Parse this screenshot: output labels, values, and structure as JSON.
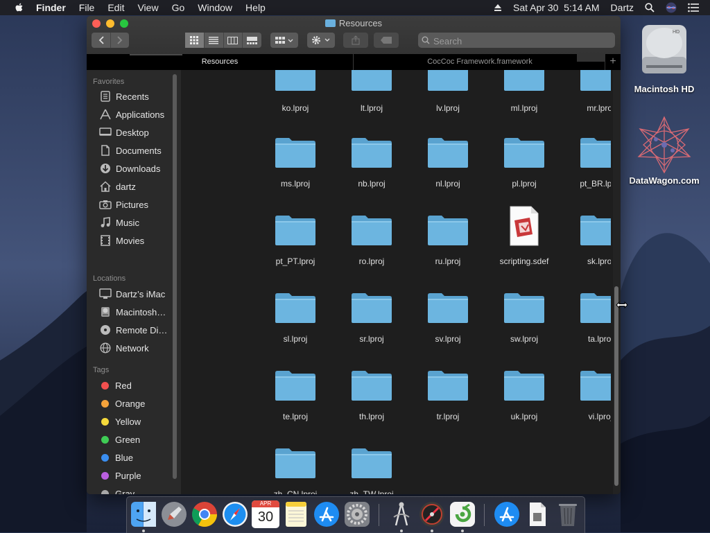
{
  "menubar": {
    "items": [
      "Finder",
      "File",
      "Edit",
      "View",
      "Go",
      "Window",
      "Help"
    ],
    "datetime": "Sat Apr 30  5:14 AM",
    "user": "Dartz"
  },
  "window": {
    "title": "Resources",
    "search_placeholder": "Search",
    "tabs": [
      "Resources",
      "CocCoc Framework.framework"
    ]
  },
  "sidebar": {
    "favorites_header": "Favorites",
    "favorites": [
      {
        "label": "Recents",
        "icon": "clock-icon"
      },
      {
        "label": "Applications",
        "icon": "applications-icon"
      },
      {
        "label": "Desktop",
        "icon": "desktop-icon"
      },
      {
        "label": "Documents",
        "icon": "documents-icon"
      },
      {
        "label": "Downloads",
        "icon": "downloads-icon"
      },
      {
        "label": "dartz",
        "icon": "home-icon"
      },
      {
        "label": "Pictures",
        "icon": "camera-icon"
      },
      {
        "label": "Music",
        "icon": "music-icon"
      },
      {
        "label": "Movies",
        "icon": "film-icon"
      }
    ],
    "locations_header": "Locations",
    "locations": [
      {
        "label": "Dartz’s iMac",
        "icon": "imac-icon"
      },
      {
        "label": "Macintosh…",
        "icon": "disk-icon"
      },
      {
        "label": "Remote Di…",
        "icon": "cd-icon"
      },
      {
        "label": "Network",
        "icon": "globe-icon"
      }
    ],
    "tags_header": "Tags",
    "tags": [
      {
        "label": "Red",
        "color": "#f2504f"
      },
      {
        "label": "Orange",
        "color": "#f5a33b"
      },
      {
        "label": "Yellow",
        "color": "#f5d93b"
      },
      {
        "label": "Green",
        "color": "#3fcc55"
      },
      {
        "label": "Blue",
        "color": "#3a8ef0"
      },
      {
        "label": "Purple",
        "color": "#bb5fe0"
      },
      {
        "label": "Gray",
        "color": "#a8a8a8"
      }
    ]
  },
  "files": {
    "partial_row": [
      "ko.lproj",
      "lt.lproj",
      "lv.lproj",
      "ml.lproj",
      "mr.lproj"
    ],
    "rows": [
      [
        "ms.lproj",
        "nb.lproj",
        "nl.lproj",
        "pl.lproj",
        "pt_BR.lproj"
      ],
      [
        "pt_PT.lproj",
        "ro.lproj",
        "ru.lproj",
        "scripting.sdef",
        "sk.lproj"
      ],
      [
        "sl.lproj",
        "sr.lproj",
        "sv.lproj",
        "sw.lproj",
        "ta.lproj"
      ],
      [
        "te.lproj",
        "th.lproj",
        "tr.lproj",
        "uk.lproj",
        "vi.lproj"
      ],
      [
        "zh_CN.lproj",
        "zh_TW.lproj"
      ]
    ]
  },
  "desktop": {
    "icons": [
      "Macintosh HD",
      "DataWagon.com"
    ]
  },
  "dock": {
    "calendar_month": "APR",
    "calendar_day": "30",
    "apps": [
      "finder-icon",
      "launchpad-icon",
      "chrome-icon",
      "safari-icon",
      "calendar-icon",
      "notes-icon",
      "app-store-icon",
      "system-preferences-icon",
      "app-icon-1",
      "app-icon-2",
      "app-icon-3",
      "app-store-folder-icon",
      "document-icon",
      "trash-icon"
    ]
  },
  "colors": {
    "folder_blue": "#62b0dc",
    "window_bg": "#1e1e1e",
    "sidebar_bg": "#2a2a2a"
  }
}
